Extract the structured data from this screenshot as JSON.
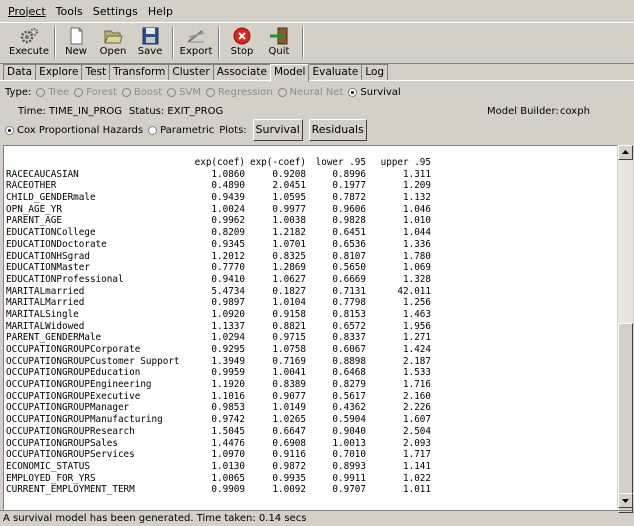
{
  "menu": [
    "Project",
    "Tools",
    "Settings",
    "Help"
  ],
  "toolbar": {
    "execute": "Execute",
    "new": "New",
    "open": "Open",
    "save": "Save",
    "export": "Export",
    "stop": "Stop",
    "quit": "Quit"
  },
  "tabs": [
    "Data",
    "Explore",
    "Test",
    "Transform",
    "Cluster",
    "Associate",
    "Model",
    "Evaluate",
    "Log"
  ],
  "type_row": {
    "label": "Type:",
    "options": [
      "Tree",
      "Forest",
      "Boost",
      "SVM",
      "Regression",
      "Neural Net",
      "Survival"
    ],
    "selected": "Survival"
  },
  "info": {
    "time": "Time: TIME_IN_PROG",
    "status": "Status: EXIT_PROG",
    "builder_label": "Model Builder:",
    "builder_value": "coxph"
  },
  "method": {
    "cox": "Cox Proportional Hazards",
    "parametric": "Parametric",
    "plots": "Plots:",
    "survival_btn": "Survival",
    "residuals_btn": "Residuals"
  },
  "output": {
    "headers": [
      "exp(coef)",
      "exp(-coef)",
      "lower .95",
      "upper .95"
    ],
    "rows": [
      [
        "RACECAUCASIAN",
        "1.0860",
        "0.9208",
        "0.8996",
        "1.311"
      ],
      [
        "RACEOTHER",
        "0.4890",
        "2.0451",
        "0.1977",
        "1.209"
      ],
      [
        "CHILD_GENDERmale",
        "0.9439",
        "1.0595",
        "0.7872",
        "1.132"
      ],
      [
        "OPN_AGE_YR",
        "1.0024",
        "0.9977",
        "0.9606",
        "1.046"
      ],
      [
        "PARENT_AGE",
        "0.9962",
        "1.0038",
        "0.9828",
        "1.010"
      ],
      [
        "EDUCATIONCollege",
        "0.8209",
        "1.2182",
        "0.6451",
        "1.044"
      ],
      [
        "EDUCATIONDoctorate",
        "0.9345",
        "1.0701",
        "0.6536",
        "1.336"
      ],
      [
        "EDUCATIONHSgrad",
        "1.2012",
        "0.8325",
        "0.8107",
        "1.780"
      ],
      [
        "EDUCATIONMaster",
        "0.7770",
        "1.2869",
        "0.5650",
        "1.069"
      ],
      [
        "EDUCATIONProfessional",
        "0.9410",
        "1.0627",
        "0.6669",
        "1.328"
      ],
      [
        "MARITALmarried",
        "5.4734",
        "0.1827",
        "0.7131",
        "42.011"
      ],
      [
        "MARITALMarried",
        "0.9897",
        "1.0104",
        "0.7798",
        "1.256"
      ],
      [
        "MARITALSingle",
        "1.0920",
        "0.9158",
        "0.8153",
        "1.463"
      ],
      [
        "MARITALWidowed",
        "1.1337",
        "0.8821",
        "0.6572",
        "1.956"
      ],
      [
        "PARENT_GENDERMale",
        "1.0294",
        "0.9715",
        "0.8337",
        "1.271"
      ],
      [
        "OCCUPATIONGROUPCorporate",
        "0.9295",
        "1.0758",
        "0.6067",
        "1.424"
      ],
      [
        "OCCUPATIONGROUPCustomer Support",
        "1.3949",
        "0.7169",
        "0.8898",
        "2.187"
      ],
      [
        "OCCUPATIONGROUPEducation",
        "0.9959",
        "1.0041",
        "0.6468",
        "1.533"
      ],
      [
        "OCCUPATIONGROUPEngineering",
        "1.1920",
        "0.8389",
        "0.8279",
        "1.716"
      ],
      [
        "OCCUPATIONGROUPExecutive",
        "1.1016",
        "0.9077",
        "0.5617",
        "2.160"
      ],
      [
        "OCCUPATIONGROUPManager",
        "0.9853",
        "1.0149",
        "0.4362",
        "2.226"
      ],
      [
        "OCCUPATIONGROUPManufacturing",
        "0.9742",
        "1.0265",
        "0.5904",
        "1.607"
      ],
      [
        "OCCUPATIONGROUPResearch",
        "1.5045",
        "0.6647",
        "0.9040",
        "2.504"
      ],
      [
        "OCCUPATIONGROUPSales",
        "1.4476",
        "0.6908",
        "1.0013",
        "2.093"
      ],
      [
        "OCCUPATIONGROUPServices",
        "1.0970",
        "0.9116",
        "0.7010",
        "1.717"
      ],
      [
        "ECONOMIC_STATUS",
        "1.0130",
        "0.9872",
        "0.8993",
        "1.141"
      ],
      [
        "EMPLOYED_FOR_YRS",
        "1.0065",
        "0.9935",
        "0.9911",
        "1.022"
      ],
      [
        "CURRENT_EMPLOYMENT_TERM",
        "0.9909",
        "1.0092",
        "0.9707",
        "1.011"
      ]
    ]
  },
  "status": "A survival model has been generated. Time taken: 0.14 secs",
  "icons": {
    "execute": "gears-icon",
    "new": "new-document-icon",
    "open": "folder-open-icon",
    "save": "floppy-disk-icon",
    "export": "export-icon",
    "stop": "stop-icon",
    "quit": "exit-door-icon"
  },
  "colors": {
    "background": "#d4d0c8",
    "stop_red": "#d9261c",
    "output_bg": "#ffffff"
  }
}
